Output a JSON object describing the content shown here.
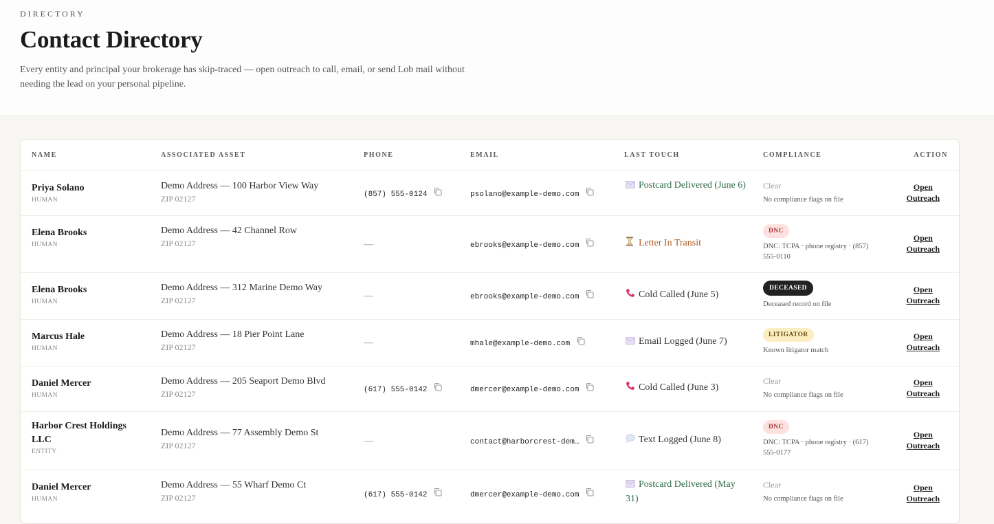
{
  "header": {
    "eyebrow": "DIRECTORY",
    "title": "Contact Directory",
    "subtitle": "Every entity and principal your brokerage has skip-traced — open outreach to call, email, or send Lob mail without needing the lead on your personal pipeline."
  },
  "table": {
    "columns": {
      "name": "NAME",
      "asset": "ASSOCIATED ASSET",
      "phone": "PHONE",
      "email": "EMAIL",
      "last_touch": "LAST TOUCH",
      "compliance": "COMPLIANCE",
      "action": "ACTION"
    },
    "rows": [
      {
        "name": "Priya Solano",
        "kind": "HUMAN",
        "asset": "Demo Address — 100 Harbor View Way",
        "zip": "ZIP 02127",
        "phone": "(857) 555-0124",
        "email": "psolano@example-demo.com",
        "touch_icon": "postcard-icon",
        "touch_text": "Postcard Delivered (June 6)",
        "touch_color": "#2f6b4a",
        "compliance_badge": "",
        "compliance_status": "Clear",
        "compliance_note": "No compliance flags on file",
        "action_line1": "Open",
        "action_line2": "Outreach"
      },
      {
        "name": "Elena Brooks",
        "kind": "HUMAN",
        "asset": "Demo Address — 42 Channel Row",
        "zip": "ZIP 02127",
        "phone": "—",
        "email": "ebrooks@example-demo.com",
        "touch_icon": "hourglass-icon",
        "touch_text": "Letter In Transit",
        "touch_color": "#b05a24",
        "compliance_badge": "DNC",
        "compliance_status": "",
        "compliance_note": "DNC: TCPA · phone registry · (857) 555-0110",
        "action_line1": "Open",
        "action_line2": "Outreach"
      },
      {
        "name": "Elena Brooks",
        "kind": "HUMAN",
        "asset": "Demo Address — 312 Marine Demo Way",
        "zip": "ZIP 02127",
        "phone": "—",
        "email": "ebrooks@example-demo.com",
        "touch_icon": "phone-icon",
        "touch_text": "Cold Called (June 5)",
        "touch_color": "#333333",
        "compliance_badge": "DECEASED",
        "compliance_status": "",
        "compliance_note": "Deceased record on file",
        "action_line1": "Open",
        "action_line2": "Outreach"
      },
      {
        "name": "Marcus Hale",
        "kind": "HUMAN",
        "asset": "Demo Address — 18 Pier Point Lane",
        "zip": "ZIP 02127",
        "phone": "—",
        "email": "mhale@example-demo.com",
        "touch_icon": "envelope-icon",
        "touch_text": "Email Logged (June 7)",
        "touch_color": "#333333",
        "compliance_badge": "LITIGATOR",
        "compliance_status": "",
        "compliance_note": "Known litigator match",
        "action_line1": "Open",
        "action_line2": "Outreach"
      },
      {
        "name": "Daniel Mercer",
        "kind": "HUMAN",
        "asset": "Demo Address — 205 Seaport Demo Blvd",
        "zip": "ZIP 02127",
        "phone": "(617) 555-0142",
        "email": "dmercer@example-demo.com",
        "touch_icon": "phone-icon",
        "touch_text": "Cold Called (June 3)",
        "touch_color": "#333333",
        "compliance_badge": "",
        "compliance_status": "Clear",
        "compliance_note": "No compliance flags on file",
        "action_line1": "Open",
        "action_line2": "Outreach"
      },
      {
        "name": "Harbor Crest Holdings LLC",
        "kind": "ENTITY",
        "asset": "Demo Address — 77 Assembly Demo St",
        "zip": "ZIP 02127",
        "phone": "—",
        "email": "contact@harborcrest-dem…",
        "touch_icon": "speech-bubble-icon",
        "touch_text": "Text Logged (June 8)",
        "touch_color": "#333333",
        "compliance_badge": "DNC",
        "compliance_status": "",
        "compliance_note": "DNC: TCPA · phone registry · (617) 555-0177",
        "action_line1": "Open",
        "action_line2": "Outreach"
      },
      {
        "name": "Daniel Mercer",
        "kind": "HUMAN",
        "asset": "Demo Address — 55 Wharf Demo Ct",
        "zip": "ZIP 02127",
        "phone": "(617) 555-0142",
        "email": "dmercer@example-demo.com",
        "touch_icon": "postcard-icon",
        "touch_text": "Postcard Delivered (May 31)",
        "touch_color": "#2f6b4a",
        "compliance_badge": "",
        "compliance_status": "Clear",
        "compliance_note": "No compliance flags on file",
        "action_line1": "Open",
        "action_line2": "Outreach"
      }
    ]
  }
}
